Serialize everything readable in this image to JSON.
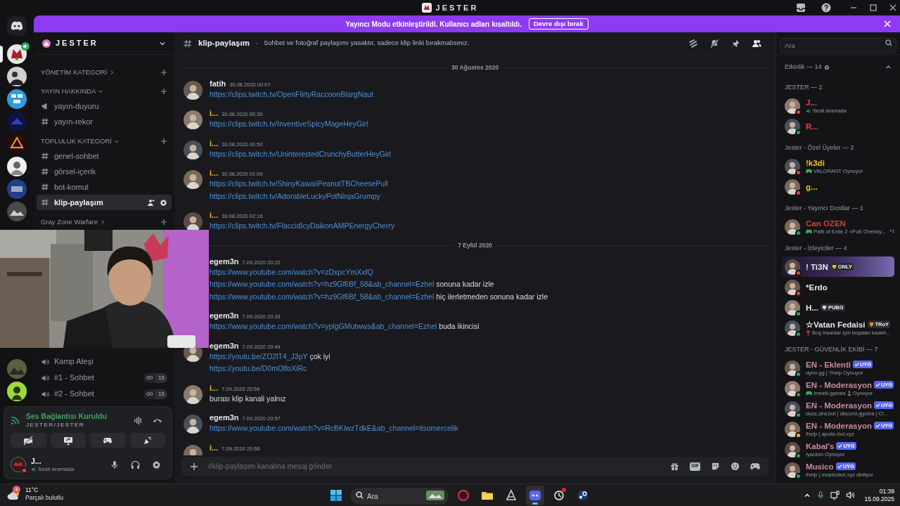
{
  "window": {
    "title": "JESTER"
  },
  "banner": {
    "message": "Yayıncı Modu etkinleştirildi. Kullanıcı adları kısaltıldı.",
    "button": "Devre dışı bırak"
  },
  "servers": [
    {
      "selected": true,
      "voice_active": true
    },
    {
      "selected": false,
      "voice_active": false
    },
    {
      "selected": false,
      "voice_active": false
    },
    {
      "selected": false,
      "voice_active": false
    },
    {
      "selected": false,
      "voice_active": false
    },
    {
      "selected": false,
      "voice_active": false
    },
    {
      "selected": false,
      "voice_active": false
    },
    {
      "selected": false,
      "voice_active": false
    },
    {
      "selected": false,
      "voice_active": false
    },
    {
      "selected": false,
      "voice_active": false
    }
  ],
  "server": {
    "name": "JESTER"
  },
  "sidebar": {
    "items": [
      {
        "kind": "category",
        "name": "YÖNETİM KATEGORİ",
        "expanded": false
      },
      {
        "kind": "category",
        "name": "YAYIN HAKKINDA",
        "expanded": true
      },
      {
        "kind": "announcement",
        "name": "yayın-duyuru",
        "selected": false
      },
      {
        "kind": "text",
        "name": "yayın-rekor",
        "selected": false
      },
      {
        "kind": "category",
        "name": "TOPLULUK KATEGORİ",
        "expanded": true
      },
      {
        "kind": "text",
        "name": "genel-sohbet",
        "selected": false
      },
      {
        "kind": "text",
        "name": "görsel-içerik",
        "selected": false
      },
      {
        "kind": "text",
        "name": "bot-komut",
        "selected": false
      },
      {
        "kind": "text",
        "name": "klip-paylaşım",
        "selected": true
      },
      {
        "kind": "category",
        "name": "Gray Zone Warfare",
        "expanded": false
      }
    ],
    "voice_channels": [
      {
        "name": "Kamp Ateşi",
        "selected": false
      },
      {
        "name": "#1 - Sohbet",
        "selected": false,
        "counts": [
          "00",
          "15"
        ]
      },
      {
        "name": "#2 - Sohbet",
        "selected": false,
        "counts": [
          "00",
          "15"
        ]
      }
    ]
  },
  "voice_panel": {
    "status": "Ses Bağlantısı Kuruldu",
    "location": "JESTER/JESTER"
  },
  "user": {
    "name": "J...",
    "status": {
      "color": "#f23f43"
    },
    "activity": "Sesli aramada"
  },
  "channel": {
    "name": "klip-paylaşım",
    "topic": "Sohbet ve fotoğraf paylaşımı yasaktır, sadece klip linki bırakmalısınız."
  },
  "search": {
    "placeholder": "Ara"
  },
  "messages": [
    {
      "kind": "divider",
      "label": "30 Ağustos 2020"
    },
    {
      "kind": "message",
      "author": "fatih",
      "color": "#e8e8ea",
      "time": "30.08.2020 00:07",
      "avatar": true,
      "lines": [
        {
          "link": "https://clips.twitch.tv/OpenFlirtyRaccoonBlargNaut"
        }
      ]
    },
    {
      "kind": "message",
      "author": "i...",
      "color": "#f0c419",
      "time": "30.08.2020 00:30",
      "avatar": true,
      "lines": [
        {
          "link": "https://clips.twitch.tv/InventiveSpicyMageHeyGirl"
        }
      ]
    },
    {
      "kind": "message",
      "author": "i...",
      "color": "#f0c419",
      "time": "30.08.2020 00:50",
      "avatar": true,
      "lines": [
        {
          "link": "https://clips.twitch.tv/UninterestedCrunchyButterHeyGirl"
        }
      ]
    },
    {
      "kind": "message",
      "author": "i...",
      "color": "#f0c419",
      "time": "30.08.2020 01:09",
      "avatar": true,
      "lines": [
        {
          "link": "https://clips.twitch.tv/ShinyKawaiiPeanutTBCheesePull"
        },
        {
          "link": "https://clips.twitch.tv/AdorableLuckyPotNinjaGrumpy"
        }
      ]
    },
    {
      "kind": "message",
      "author": "i...",
      "color": "#f0c419",
      "time": "30.08.2020 02:16",
      "avatar": true,
      "lines": [
        {
          "link": "https://clips.twitch.tv/FlaccidIcyDaikonAMPEnergyCherry"
        }
      ]
    },
    {
      "kind": "divider",
      "label": "7 Eylül 2020"
    },
    {
      "kind": "message",
      "author": "egem3n",
      "color": "#e8e8ea",
      "time": "7.09.2020 20:22",
      "avatar": false,
      "lines": [
        {
          "link": "https://www.youtube.com/watch?v=zDxpcYmXxfQ"
        },
        {
          "link": "https://www.youtube.com/watch?v=hz9Gf6Bf_58&ab_channel=Ezhel",
          "text": "sonuna kadar izle"
        },
        {
          "link": "https://www.youtube.com/watch?v=hz9Gf6Bf_58&ab_channel=Ezhel",
          "text": "hiç ilerletmeden sonuna kadar izle"
        }
      ]
    },
    {
      "kind": "message",
      "author": "egem3n",
      "color": "#e8e8ea",
      "time": "7.09.2020 20:33",
      "avatar": false,
      "lines": [
        {
          "link": "https://www.youtube.com/watch?v=yplgGMutwws&ab_channel=Ezhel",
          "text": "buda ikincisi"
        }
      ]
    },
    {
      "kind": "message",
      "author": "egem3n",
      "color": "#e8e8ea",
      "time": "7.09.2020 20:49",
      "avatar": true,
      "lines": [
        {
          "link": "https://youtu.be/ZO2lT4_J3pY",
          "text": "çok iyi"
        },
        {
          "link": "https://youtu.be/D0mOlfoXiRc"
        }
      ]
    },
    {
      "kind": "message",
      "author": "i...",
      "color": "#f0c419",
      "time": "7.09.2020 20:56",
      "avatar": true,
      "lines": [
        {
          "text": "burası klip kanali yalnız"
        }
      ]
    },
    {
      "kind": "message",
      "author": "egem3n",
      "color": "#e8e8ea",
      "time": "7.09.2020 20:57",
      "avatar": true,
      "lines": [
        {
          "link": "https://www.youtube.com/watch?v=RcBKlwzTdkE&ab_channel=itsomercelik"
        }
      ]
    },
    {
      "kind": "message",
      "author": "i...",
      "color": "#f0c419",
      "time": "7.09.2020 20:58",
      "avatar": true
    }
  ],
  "composer": {
    "placeholder": "#klip-paylaşım kanalına mesaj gönder",
    "gif_label": "GIF"
  },
  "members": {
    "header": "Etkinlik — 14",
    "sections": [
      {
        "title": "JESTER — 2",
        "members": [
          {
            "name": "J...",
            "color": "#e5484d",
            "status": {
              "color": "#f23f43"
            },
            "nameplate": false,
            "activity": {
              "kind": "voice",
              "text": "Sesli aramada"
            }
          },
          {
            "name": "R...",
            "color": "#e5484d",
            "status": {
              "color": "#23a55a"
            },
            "nameplate": false
          }
        ]
      },
      {
        "title": "Jester - Özel Üyeler — 2",
        "members": [
          {
            "name": "!k3di",
            "color": "#f0c419",
            "status": {
              "color": "#f23f43"
            },
            "nameplate": false,
            "activity": {
              "kind": "playing",
              "text": "VALORANT Oynuyor"
            }
          },
          {
            "name": "g...",
            "color": "#f0c419",
            "status": {
              "color": "#f23f43"
            },
            "nameplate": false
          }
        ]
      },
      {
        "title": "Jester - Yayıncı Dostlar — 1",
        "members": [
          {
            "name": "Can OZEN",
            "color": "#c8453c",
            "status": {
              "color": "#23a55a"
            },
            "nameplate": false,
            "activity": {
              "kind": "playing",
              "text": "Path of Exile 2 <PoE Overlay...",
              "extra": "+1"
            }
          }
        ]
      },
      {
        "title": "Jester - İzleyiciler — 4",
        "members": [
          {
            "name": "! Ti3N",
            "color": "#e8e8ea",
            "status": {
              "color": "#f23f43"
            },
            "nameplate": true,
            "badge": {
              "kind": "guild_tag",
              "label": "ONLY",
              "color": "#e2b53a"
            }
          },
          {
            "name": "*Erdo",
            "color": "#e8e8ea",
            "status": {
              "color": "#f23f43"
            },
            "nameplate": false
          },
          {
            "name": "H...",
            "color": "#e8e8ea",
            "status": {
              "color": "#23a55a"
            },
            "nameplate": false,
            "badge": {
              "kind": "guild_tag",
              "label": "PUBG",
              "color": "#d8d8d8"
            }
          },
          {
            "name": "☆Vatan Fedaisi",
            "color": "#e8e8ea",
            "status": {
              "color": "#23a55a"
            },
            "nameplate": false,
            "badge": {
              "kind": "guild_tag",
              "label": "TRoY",
              "color": "#f08a2c"
            },
            "activity": {
              "kind": "custom",
              "text": "Boş insanlar için boşalan kadeh..."
            }
          }
        ]
      },
      {
        "title": "JESTER - GÜVENLİK EKİBİ — 7",
        "members": [
          {
            "name": "EN - Eklenti",
            "color": "#c98a9c",
            "status": {
              "color": "#23a55a"
            },
            "nameplate": false,
            "badge": {
              "kind": "bot",
              "label": "UYG"
            },
            "activity": {
              "kind": "plain",
              "text": "dyno.gg | ?help Oynuyor"
            }
          },
          {
            "name": "EN - Moderasyon",
            "color": "#c98a9c",
            "status": {
              "color": "#23a55a"
            },
            "nameplate": false,
            "badge": {
              "kind": "bot",
              "label": "UYG"
            },
            "activity": {
              "kind": "playing",
              "text": "/mee6-games",
              "suffix": "Oynuyor"
            }
          },
          {
            "name": "EN - Moderasyon",
            "color": "#c98a9c",
            "status": {
              "color": "#23a55a"
            },
            "nameplate": false,
            "badge": {
              "kind": "bot",
              "label": "UYG"
            },
            "activity": {
              "kind": "plain",
              "text": "docs.zira.bot | discord.gg/zira | Cl..."
            }
          },
          {
            "name": "EN - Moderasyon",
            "color": "#c98a9c",
            "status": {
              "color": "#f0b232"
            },
            "nameplate": false,
            "badge": {
              "kind": "bot",
              "label": "UYG"
            },
            "activity": {
              "kind": "plain",
              "text": "/help | apollo-bot.xyz"
            }
          },
          {
            "name": "Kabal's",
            "color": "#c98a9c",
            "status": {
              "color": "#23a55a"
            },
            "nameplate": false,
            "badge": {
              "kind": "bot",
              "label": "UYG"
            },
            "activity": {
              "kind": "plain",
              "text": "/yardım Oynuyor"
            }
          },
          {
            "name": "Musico",
            "color": "#c98a9c",
            "status": {
              "color": "#23a55a"
            },
            "nameplate": false,
            "badge": {
              "kind": "bot",
              "label": "UYG"
            },
            "activity": {
              "kind": "plain",
              "text": "/help | musicobot.xyz dinliyor"
            }
          }
        ]
      }
    ]
  },
  "taskbar": {
    "weather": {
      "temperature": "11°C",
      "description": "Parçalı bulutlu",
      "badge": "4"
    },
    "search": {
      "placeholder": "Ara"
    },
    "apps": [
      {
        "selected": false,
        "notification": false
      },
      {
        "selected": false,
        "notification": false
      },
      {
        "selected": false,
        "notification": false
      },
      {
        "selected": true,
        "notification": false
      },
      {
        "selected": false,
        "notification": true
      },
      {
        "selected": false,
        "notification": false
      }
    ],
    "time": "01:39",
    "date": "15.09.2025"
  }
}
